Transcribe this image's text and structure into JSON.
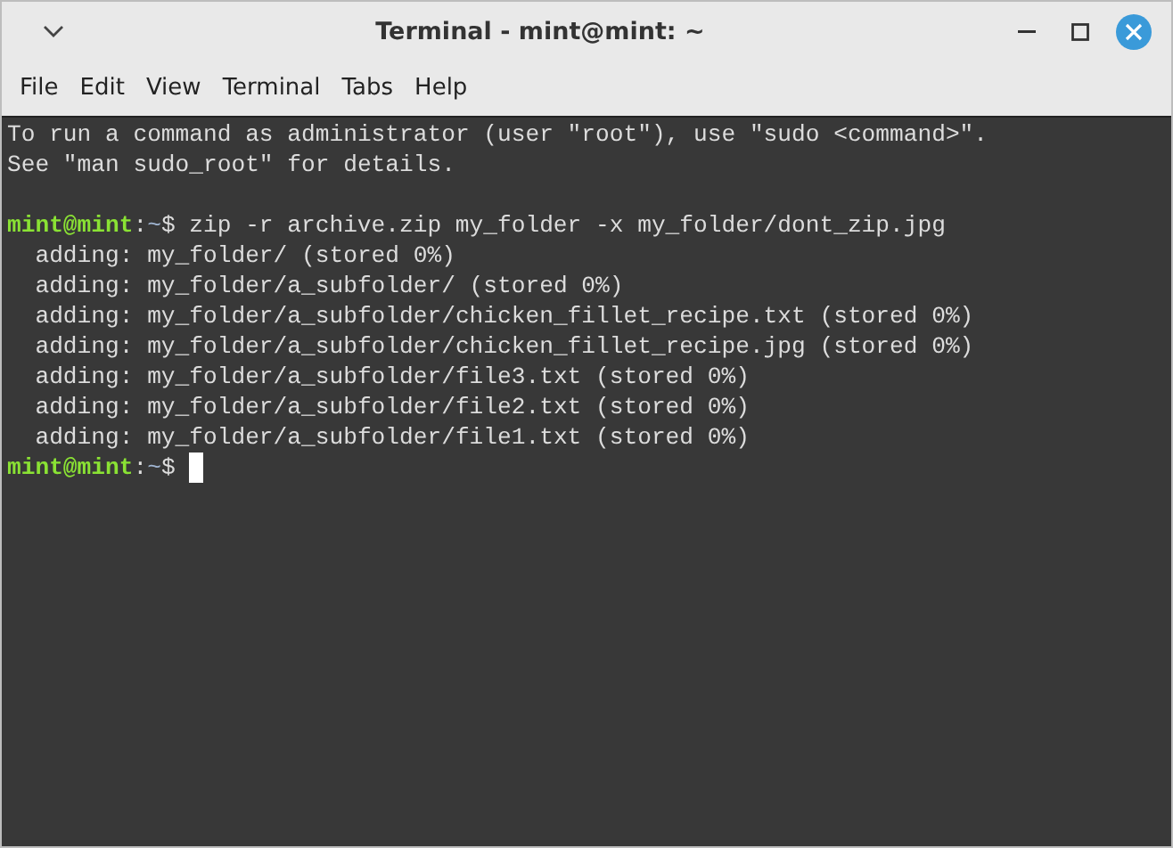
{
  "window": {
    "title": "Terminal - mint@mint: ~"
  },
  "menu": [
    "File",
    "Edit",
    "View",
    "Terminal",
    "Tabs",
    "Help"
  ],
  "terminal": {
    "lines": [
      {
        "kind": "text",
        "text": "To run a command as administrator (user \"root\"), use \"sudo <command>\"."
      },
      {
        "kind": "text",
        "text": "See \"man sudo_root\" for details."
      },
      {
        "kind": "blank"
      },
      {
        "kind": "prompt",
        "user_host": "mint@mint",
        "separator": ":",
        "path": "~",
        "symbol": "$",
        "command": "zip -r archive.zip my_folder -x my_folder/dont_zip.jpg",
        "cursor": false
      },
      {
        "kind": "text",
        "text": "  adding: my_folder/ (stored 0%)"
      },
      {
        "kind": "text",
        "text": "  adding: my_folder/a_subfolder/ (stored 0%)"
      },
      {
        "kind": "text",
        "text": "  adding: my_folder/a_subfolder/chicken_fillet_recipe.txt (stored 0%)"
      },
      {
        "kind": "text",
        "text": "  adding: my_folder/a_subfolder/chicken_fillet_recipe.jpg (stored 0%)"
      },
      {
        "kind": "text",
        "text": "  adding: my_folder/a_subfolder/file3.txt (stored 0%)"
      },
      {
        "kind": "text",
        "text": "  adding: my_folder/a_subfolder/file2.txt (stored 0%)"
      },
      {
        "kind": "text",
        "text": "  adding: my_folder/a_subfolder/file1.txt (stored 0%)"
      },
      {
        "kind": "prompt",
        "user_host": "mint@mint",
        "separator": ":",
        "path": "~",
        "symbol": "$",
        "cursor": true
      }
    ]
  }
}
